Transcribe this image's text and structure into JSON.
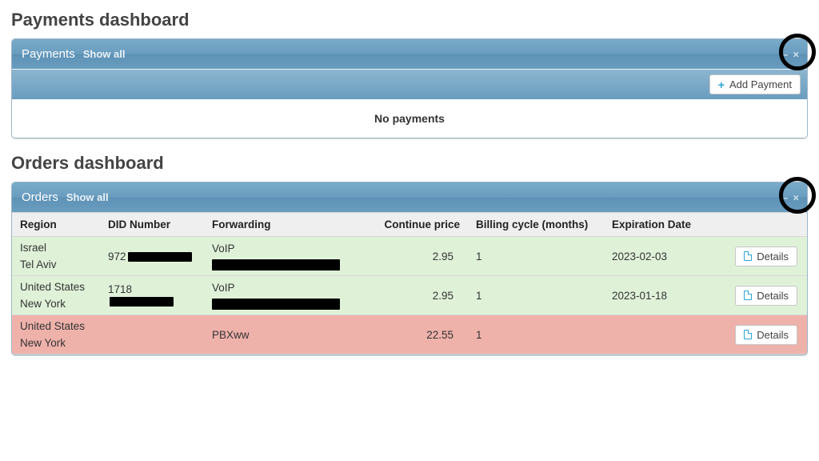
{
  "payments": {
    "section_heading": "Payments dashboard",
    "panel_title": "Payments",
    "showall_label": "Show all",
    "minimize_glyph": "–",
    "close_glyph": "×",
    "add_payment_label": "Add Payment",
    "empty_message": "No payments"
  },
  "orders": {
    "section_heading": "Orders dashboard",
    "panel_title": "Orders",
    "showall_label": "Show all",
    "minimize_glyph": "–",
    "close_glyph": "×",
    "columns": {
      "region": "Region",
      "did": "DID Number",
      "forwarding": "Forwarding",
      "price": "Continue price",
      "cycle": "Billing cycle (months)",
      "expiration": "Expiration Date",
      "actions": ""
    },
    "details_label": "Details",
    "rows": [
      {
        "status": "green",
        "region_line1": "Israel",
        "region_line2": "Tel Aviv",
        "did_prefix": "972",
        "did_redacted": true,
        "fwd_line1": "VoIP",
        "fwd_redacted": true,
        "price": "2.95",
        "cycle": "1",
        "expiration": "2023-02-03"
      },
      {
        "status": "green",
        "region_line1": "United States",
        "region_line2": "New York",
        "did_prefix": "1718",
        "did_redacted": true,
        "fwd_line1": "VoIP",
        "fwd_redacted": true,
        "price": "2.95",
        "cycle": "1",
        "expiration": "2023-01-18"
      },
      {
        "status": "red",
        "region_line1": "United States",
        "region_line2": "New York",
        "did_prefix": "",
        "did_redacted": false,
        "fwd_line1": "PBXww",
        "fwd_redacted": false,
        "price": "22.55",
        "cycle": "1",
        "expiration": ""
      }
    ]
  }
}
